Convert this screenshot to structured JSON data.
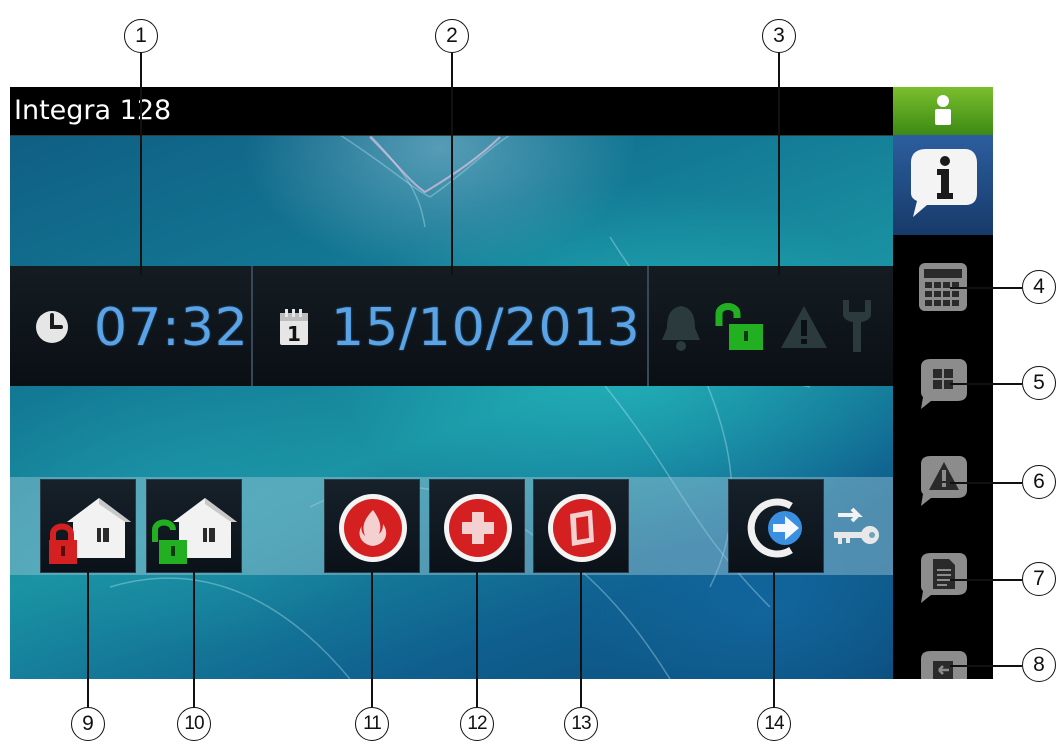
{
  "header": {
    "title": "Integra 128"
  },
  "status": {
    "time": "07:32",
    "date": "15/10/2013",
    "calendar_day": "1"
  },
  "callouts": [
    "1",
    "2",
    "3",
    "4",
    "5",
    "6",
    "7",
    "8",
    "9",
    "10",
    "11",
    "12",
    "13",
    "14"
  ],
  "icons": {
    "sidebar": [
      "user-icon",
      "info-icon",
      "calculator-icon",
      "partitions-icon",
      "troubles-icon",
      "event-log-icon",
      "exit-icon"
    ],
    "status": [
      "clock-icon",
      "calendar-icon",
      "alarm-bell-icon",
      "unlocked-padlock-icon",
      "warning-icon",
      "service-wrench-icon"
    ],
    "buttons": [
      "arm-house-icon",
      "disarm-house-icon",
      "fire-alarm-icon",
      "medical-alarm-icon",
      "panic-alarm-icon",
      "exit-arrow-icon",
      "key-transfer-icon"
    ]
  },
  "colors": {
    "accent_blue": "#5aa3e6",
    "green": "#22b022",
    "red": "#d42020",
    "sidebar_green": "#5fa524"
  }
}
